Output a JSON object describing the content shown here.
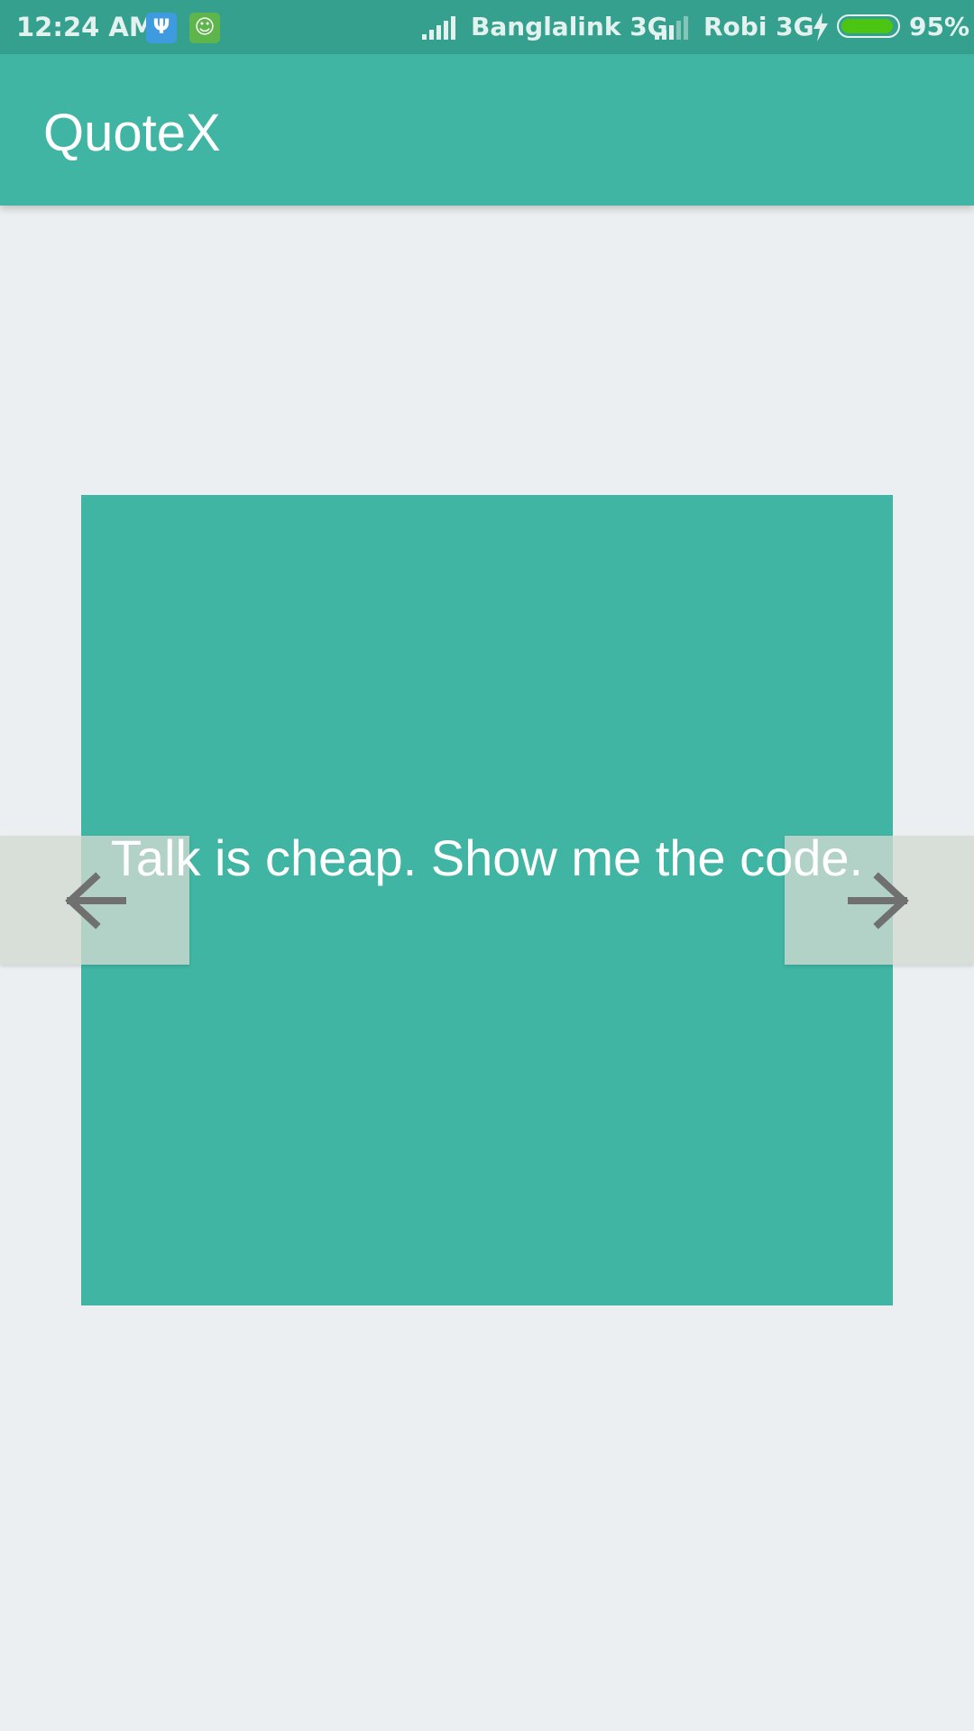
{
  "status_bar": {
    "time": "12:24 AM",
    "carrier_1": "Banglalink 3G",
    "carrier_2": "Robi 3G",
    "battery_percent": "95%",
    "battery_level": 0.95,
    "icons": [
      "usb-icon",
      "android-icon",
      "signal-icon",
      "signal-icon",
      "charging-icon",
      "battery-icon"
    ]
  },
  "app_bar": {
    "title": "QuoteX"
  },
  "quote": {
    "text": "Talk is cheap. Show me the code."
  },
  "navigation": {
    "prev_icon": "arrow-left-icon",
    "next_icon": "arrow-right-icon"
  },
  "colors": {
    "primary": "#40B5A4",
    "status_bar": "#36A08F",
    "background": "#ECEFF1",
    "nav_arrow": "#707070"
  }
}
